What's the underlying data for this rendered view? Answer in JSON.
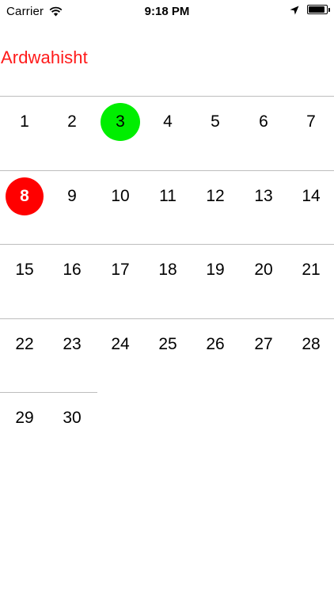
{
  "status_bar": {
    "carrier": "Carrier",
    "time": "9:18 PM",
    "battery_level": 0.9,
    "icons": [
      "wifi-icon",
      "location-icon",
      "battery-icon"
    ]
  },
  "calendar": {
    "month": "Ardwahisht",
    "weeks": [
      [
        "1",
        "2",
        "3",
        "4",
        "5",
        "6",
        "7"
      ],
      [
        "8",
        "9",
        "10",
        "11",
        "12",
        "13",
        "14"
      ],
      [
        "15",
        "16",
        "17",
        "18",
        "19",
        "20",
        "21"
      ],
      [
        "22",
        "23",
        "24",
        "25",
        "26",
        "27",
        "28"
      ],
      [
        "29",
        "30"
      ]
    ],
    "highlighted_today": "3",
    "highlighted_marked": "8"
  },
  "colors": {
    "accent": "#ff1a1a",
    "today_circle": "#00ee00",
    "marked_circle": "#ff0000",
    "separator": "#bdbdbd"
  }
}
